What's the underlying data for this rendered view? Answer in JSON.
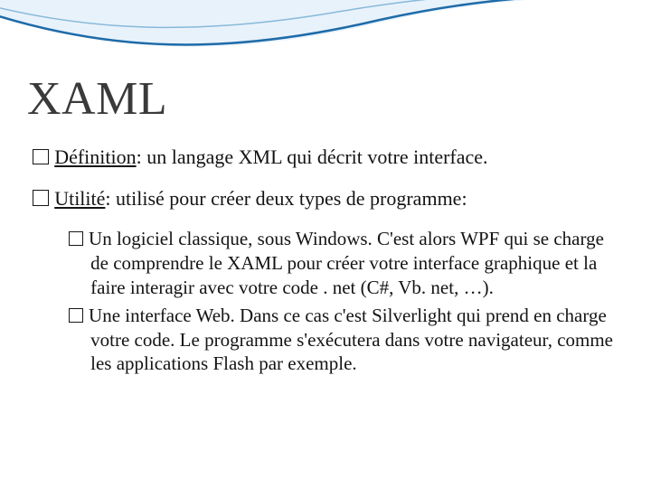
{
  "title": "XAML",
  "points": [
    {
      "label": "Définition",
      "text": ": un langage XML qui décrit votre interface."
    },
    {
      "label": "Utilité",
      "text": ": utilisé pour créer deux types de programme:",
      "sub": [
        "Un logiciel classique, sous Windows. C'est alors WPF qui se charge de comprendre le XAML pour créer votre interface graphique et la faire interagir avec votre code . net (C#, Vb. net, …).",
        "Une interface Web. Dans ce cas c'est Silverlight qui prend en charge votre code. Le programme s'exécutera dans votre navigateur, comme les applications Flash par exemple."
      ]
    }
  ]
}
